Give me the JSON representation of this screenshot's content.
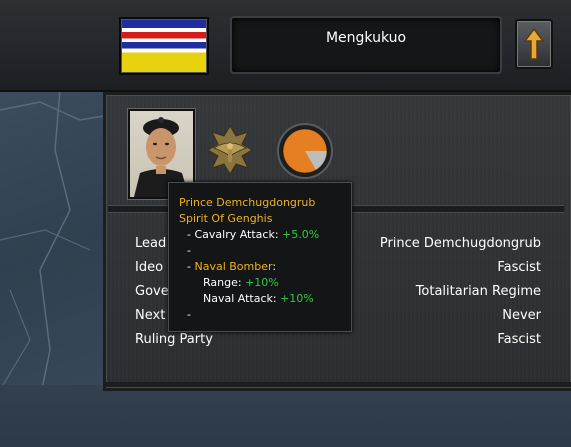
{
  "country": {
    "name": "Mengkukuo"
  },
  "flag": {
    "stripes": [
      "#1e2ea0",
      "#ffffff",
      "#d41c1c",
      "#ffffff",
      "#1e2ea0",
      "#ffffff",
      "#e8d210"
    ]
  },
  "nav": {
    "up_icon": "arrow-up-icon"
  },
  "leader": {
    "portrait_icon": "leader-portrait",
    "emblem_icon": "eagle-emblem-icon",
    "ideology_icon": "ideology-pie-icon"
  },
  "info_rows": [
    {
      "label": "Lead",
      "value": "Prince Demchugdongrub"
    },
    {
      "label": "Ideo",
      "value": "Fascist"
    },
    {
      "label": "Gove",
      "value": "Totalitarian Regime"
    },
    {
      "label": "Next",
      "value": "Never"
    },
    {
      "label": "Ruling Party",
      "value": "Fascist"
    }
  ],
  "tooltip": {
    "name": "Prince Demchugdongrub",
    "trait": "Spirit Of Genghis",
    "line1_prefix": "- Cavalry Attack: ",
    "line1_value": "+5.0%",
    "line2": "-",
    "line3_prefix": "- ",
    "line3_unit": "Naval Bomber",
    "line3_suffix": ":",
    "line4_prefix": "Range: ",
    "line4_value": "+10%",
    "line5_prefix": "Naval Attack: ",
    "line5_value": "+10%",
    "line6": "-"
  },
  "colors": {
    "gold": "#f0b11c",
    "green": "#2ecc40",
    "ideology_orange": "#e67e22"
  }
}
